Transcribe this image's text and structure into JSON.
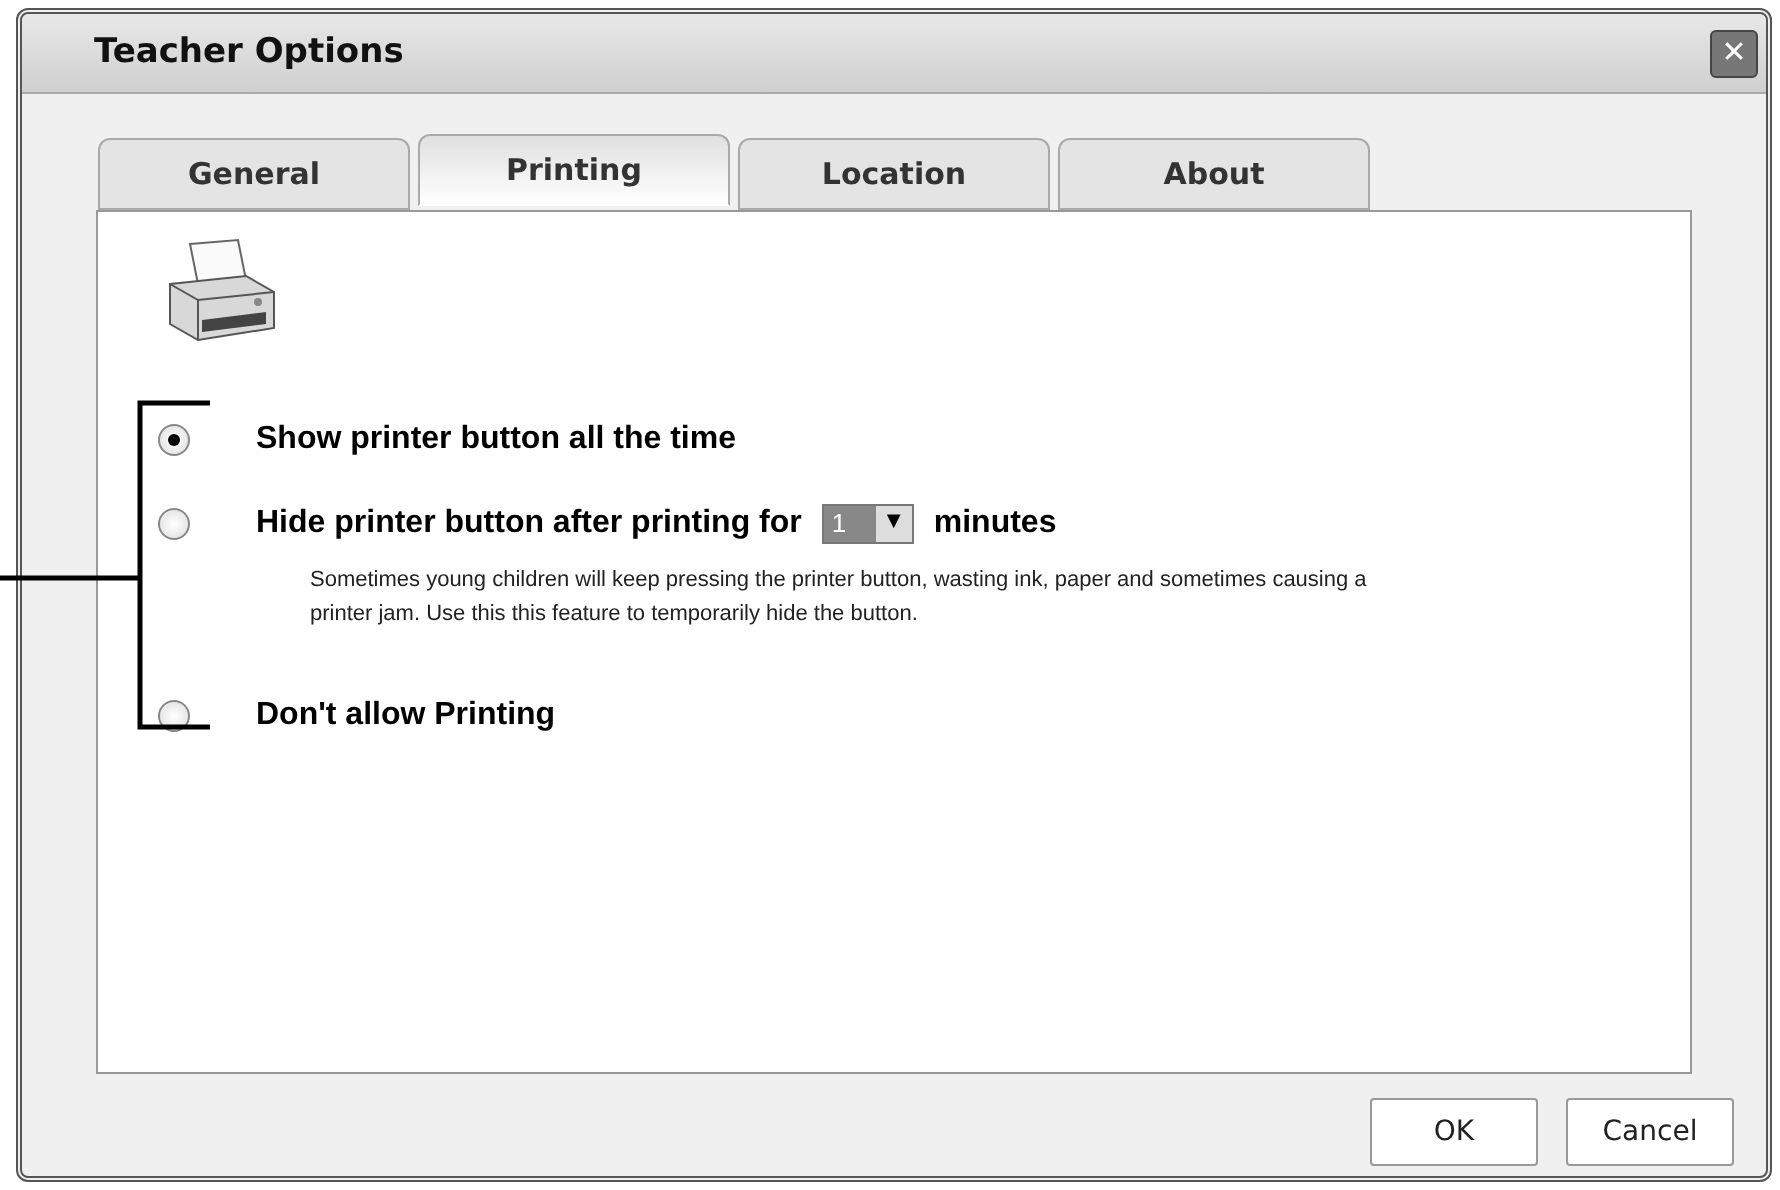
{
  "window": {
    "title": "Teacher Options",
    "close": "✕"
  },
  "tabs": [
    {
      "label": "General",
      "selected": false
    },
    {
      "label": "Printing",
      "selected": true
    },
    {
      "label": "Location",
      "selected": false
    },
    {
      "label": "About",
      "selected": false
    }
  ],
  "options": [
    {
      "label": "Show printer button all the time",
      "selected": true
    },
    {
      "label": "Hide printer button after printing for",
      "selected": false,
      "dropdown": {
        "value": "1",
        "arrow": "▼"
      },
      "suffix": "minutes",
      "description": "Sometimes young children will keep pressing the printer button, wasting ink, paper and sometimes causing a printer jam. Use this this feature to temporarily hide the button."
    },
    {
      "label": "Don't allow Printing",
      "selected": false
    }
  ],
  "buttons": [
    "OK",
    "Cancel"
  ]
}
